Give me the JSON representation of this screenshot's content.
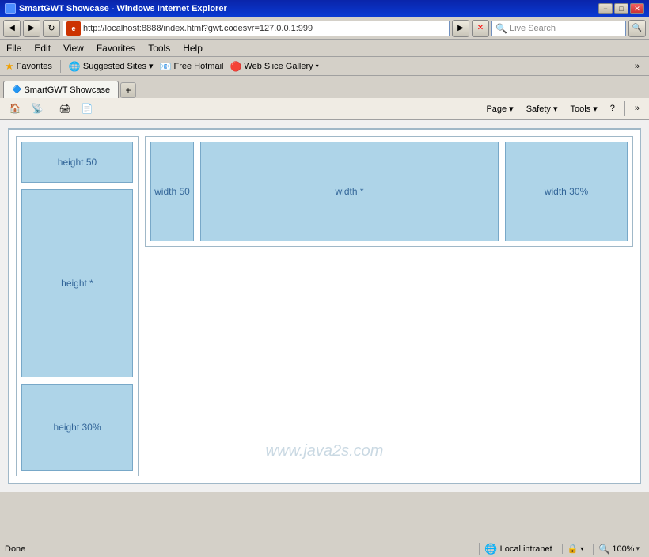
{
  "titlebar": {
    "title": "SmartGWT Showcase - Windows Internet Explorer",
    "min_label": "−",
    "max_label": "□",
    "close_label": "✕"
  },
  "addressbar": {
    "url": "http://localhost:8888/index.html?gwt.codesvr=127.0.0.1:999",
    "search_placeholder": "Live Search",
    "search_label": "Search"
  },
  "menubar": {
    "items": [
      "File",
      "Edit",
      "View",
      "Favorites",
      "Tools",
      "Help"
    ]
  },
  "favoritesbar": {
    "favorites_label": "Favorites",
    "suggested_label": "Suggested Sites ▾",
    "hotmail_label": "Free Hotmail",
    "webslice_label": "Web Slice Gallery",
    "webslice_arrow": "▾"
  },
  "tab": {
    "label": "SmartGWT Showcase"
  },
  "toolbar": {
    "page_label": "Page ▾",
    "safety_label": "Safety ▾",
    "tools_label": "Tools ▾",
    "help_label": "?"
  },
  "content": {
    "cells": {
      "left": [
        {
          "label": "height 50",
          "type": "h50"
        },
        {
          "label": "height *",
          "type": "hstar"
        },
        {
          "label": "height 30%",
          "type": "h30pct"
        }
      ],
      "top": [
        {
          "label": "width 50",
          "type": "w50"
        },
        {
          "label": "width *",
          "type": "wstar"
        },
        {
          "label": "width 30%",
          "type": "w30"
        }
      ]
    },
    "watermark": "www.java2s.com"
  },
  "statusbar": {
    "status": "Done",
    "zone_label": "Local intranet",
    "zoom_label": "100%",
    "zoom_arrow": "▾",
    "lock_icon": "🔒"
  }
}
